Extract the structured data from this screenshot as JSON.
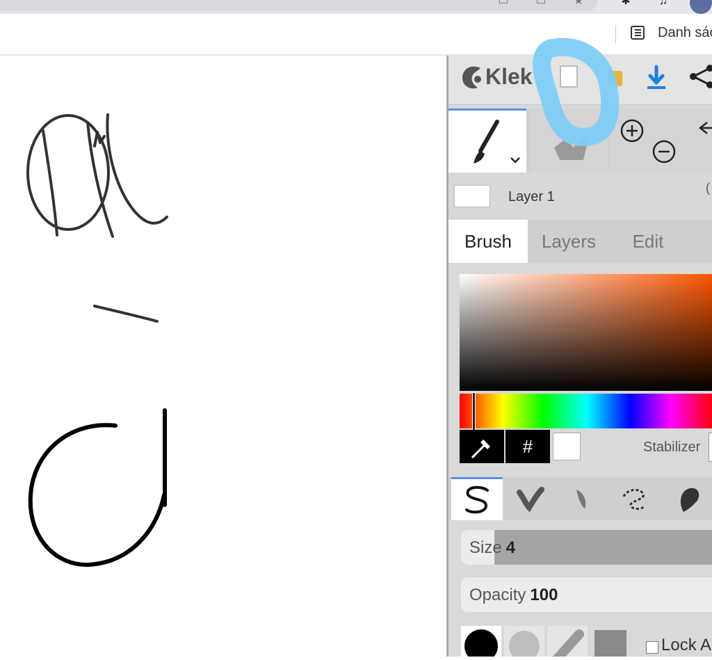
{
  "browser": {
    "reading_list_label": "Danh sác"
  },
  "app": {
    "logo_text": "Klek"
  },
  "layer": {
    "name": "Layer 1",
    "extra": "("
  },
  "tabs": [
    {
      "label": "Brush"
    },
    {
      "label": "Layers"
    },
    {
      "label": "Edit"
    }
  ],
  "color": {
    "hex_label": "#",
    "current": "#ffffff",
    "stabilizer_label": "Stabilizer"
  },
  "size": {
    "label": "Size",
    "value": "4"
  },
  "opacity": {
    "label": "Opacity",
    "value": "100"
  },
  "lock": {
    "label": "Lock A"
  },
  "colors": {
    "accent": "#5b8fe0",
    "highlight": "#7ecdf5",
    "download": "#1f7ee0"
  }
}
